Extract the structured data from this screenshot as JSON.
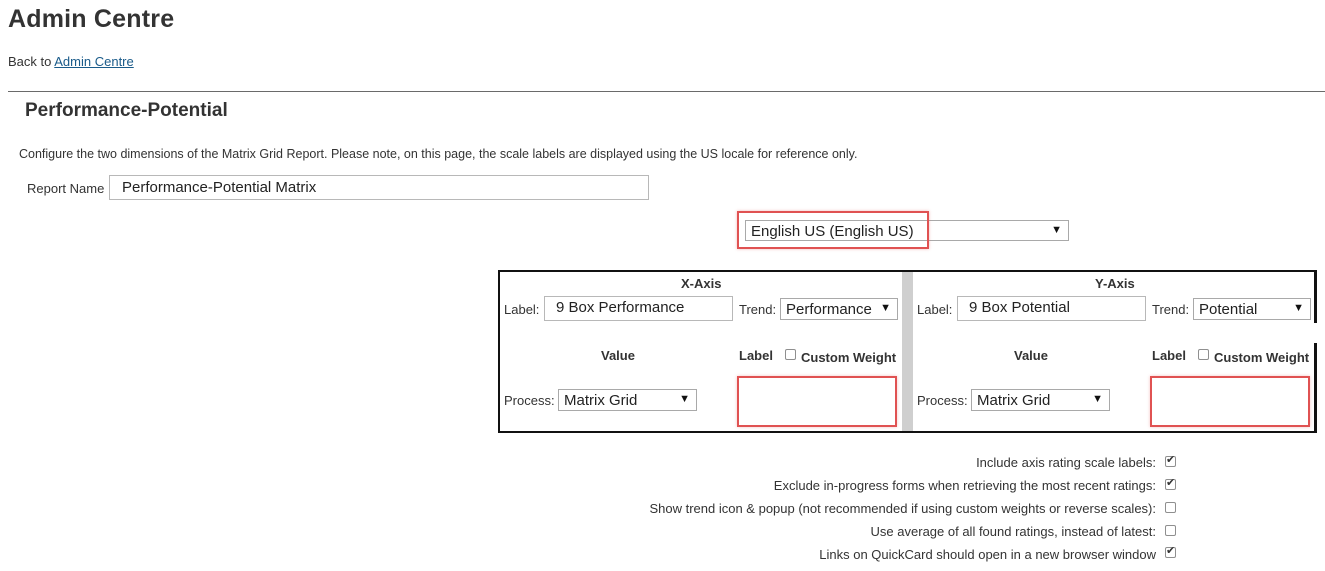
{
  "header": {
    "title": "Admin Centre",
    "back_prefix": "Back to",
    "back_link": "Admin Centre"
  },
  "section": {
    "title": "Performance-Potential",
    "description": "Configure the two dimensions of the Matrix Grid Report. Please note, on this page, the scale labels are displayed using the US locale for reference only."
  },
  "report_name": {
    "label": "Report Name",
    "value": "Performance-Potential Matrix"
  },
  "locale": {
    "selected": "English US (English US)"
  },
  "x_axis": {
    "title": "X-Axis",
    "label_caption": "Label:",
    "label_value": "9 Box Performance",
    "trend_caption": "Trend:",
    "trend_value": "Performance",
    "value_header": "Value",
    "label_header": "Label",
    "custom_weight": "Custom Weight",
    "custom_weight_checked": false,
    "process_caption": "Process:",
    "process_value": "Matrix Grid"
  },
  "y_axis": {
    "title": "Y-Axis",
    "label_caption": "Label:",
    "label_value": "9 Box Potential",
    "trend_caption": "Trend:",
    "trend_value": "Potential",
    "value_header": "Value",
    "label_header": "Label",
    "custom_weight": "Custom Weight",
    "custom_weight_checked": false,
    "process_caption": "Process:",
    "process_value": "Matrix Grid"
  },
  "options": [
    {
      "label": "Include axis rating scale labels:",
      "checked": true
    },
    {
      "label": "Exclude in-progress forms when retrieving the most recent ratings:",
      "checked": true
    },
    {
      "label": "Show trend icon & popup (not recommended if using custom weights or reverse scales):",
      "checked": false
    },
    {
      "label": "Use average of all found ratings, instead of latest:",
      "checked": false
    },
    {
      "label": "Links on QuickCard should open in a new browser window",
      "checked": true
    }
  ],
  "colors": {
    "highlight_red": "#e05252",
    "link_blue": "#1a5b8a",
    "divider_gray": "#cfcfcf"
  }
}
